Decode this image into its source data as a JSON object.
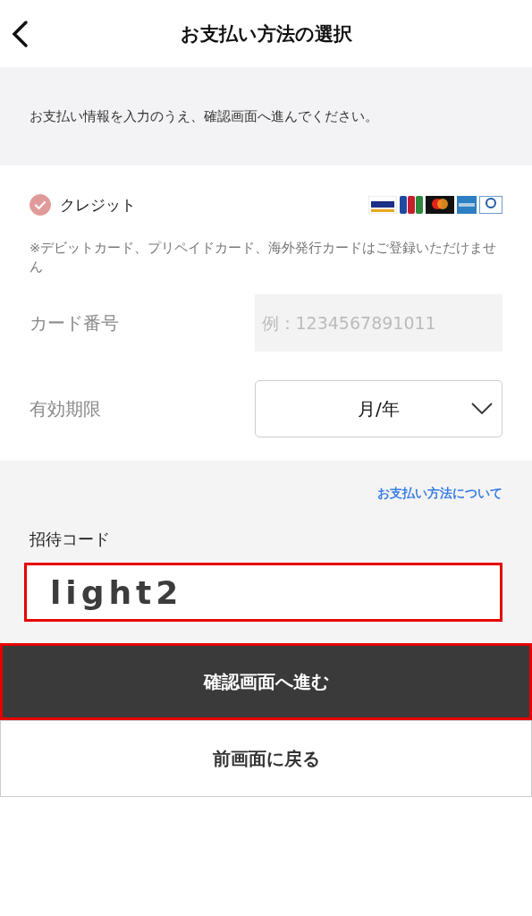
{
  "header": {
    "title": "お支払い方法の選択"
  },
  "notice": "お支払い情報を入力のうえ、確認画面へ進んでください。",
  "payment_methods": [
    {
      "label": "クレジット",
      "selected": true
    }
  ],
  "card_note": "※デビットカード、プリペイドカード、海外発行カードはご登録いただけません",
  "card_number": {
    "label": "カード番号",
    "placeholder": "例：1234567891011"
  },
  "expiry": {
    "label": "有効期限",
    "value": "月/年"
  },
  "payment_info_link": "お支払い方法について",
  "invite_code": {
    "label": "招待コード",
    "value": "light2",
    "highlighted": true
  },
  "buttons": [
    {
      "label": "確認画面へ進む",
      "kind": "primary",
      "highlighted": true
    },
    {
      "label": "前画面に戻る",
      "kind": "secondary",
      "highlighted": false
    }
  ]
}
